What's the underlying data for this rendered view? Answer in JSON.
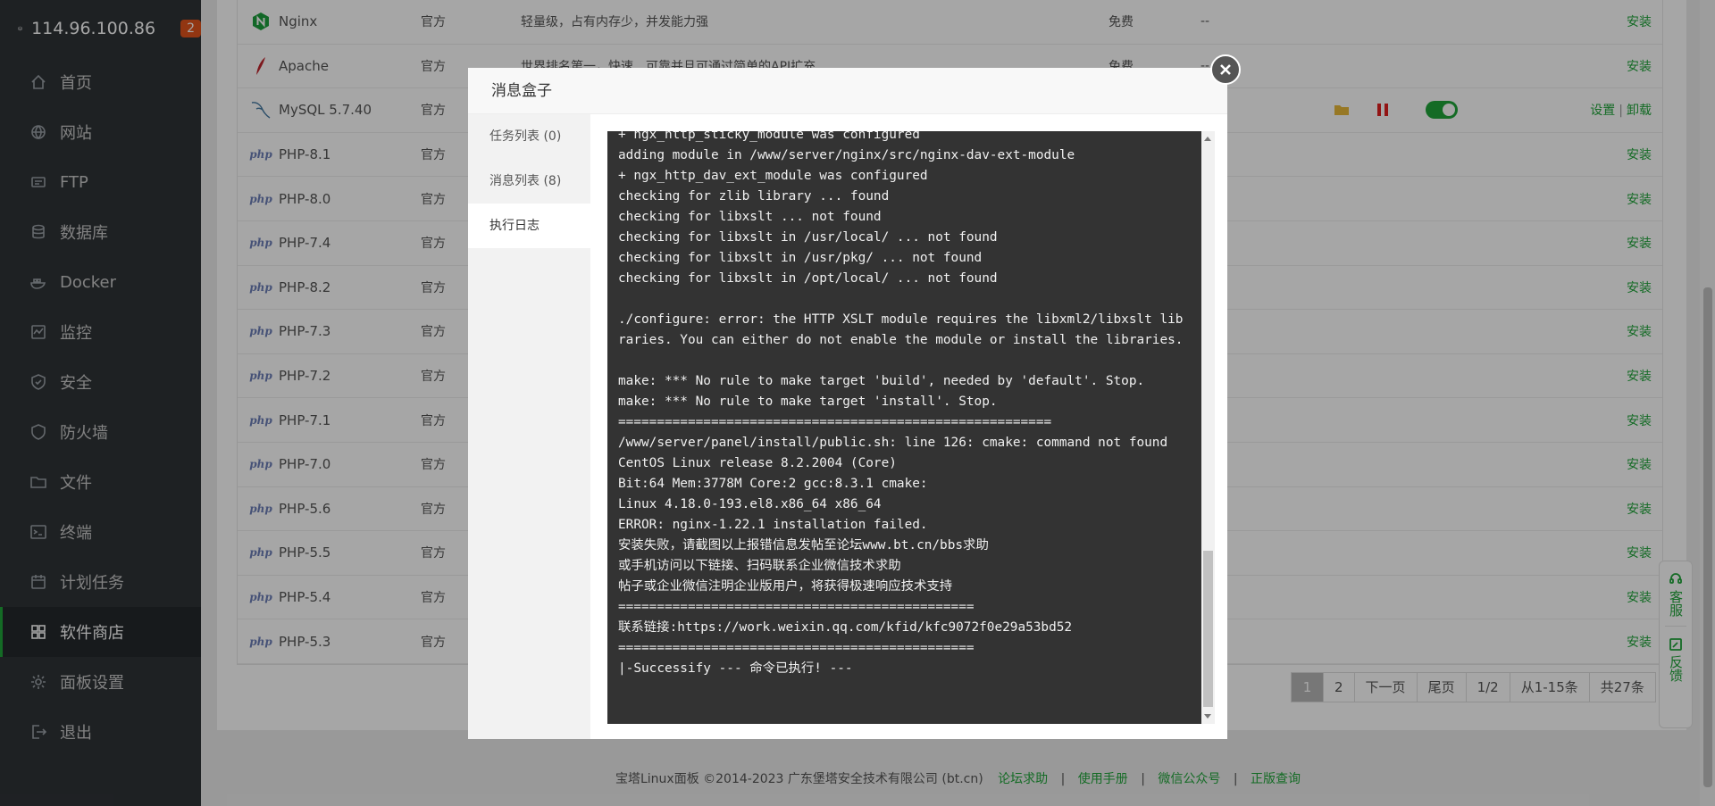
{
  "sidebar": {
    "server_ip": "114.96.100.86",
    "badge_count": "2",
    "items": [
      {
        "label": "首页",
        "icon": "home-icon"
      },
      {
        "label": "网站",
        "icon": "globe-icon"
      },
      {
        "label": "FTP",
        "icon": "ftp-icon"
      },
      {
        "label": "数据库",
        "icon": "database-icon"
      },
      {
        "label": "Docker",
        "icon": "docker-icon"
      },
      {
        "label": "监控",
        "icon": "monitor-icon"
      },
      {
        "label": "安全",
        "icon": "shield-icon"
      },
      {
        "label": "防火墙",
        "icon": "firewall-icon"
      },
      {
        "label": "文件",
        "icon": "folder-icon"
      },
      {
        "label": "终端",
        "icon": "terminal-icon"
      },
      {
        "label": "计划任务",
        "icon": "calendar-icon"
      },
      {
        "label": "软件商店",
        "icon": "grid-icon",
        "active": true
      },
      {
        "label": "面板设置",
        "icon": "gear-icon"
      },
      {
        "label": "退出",
        "icon": "logout-icon"
      }
    ]
  },
  "software_table": {
    "rows": [
      {
        "name": "Nginx",
        "type": "官方",
        "desc": "轻量级，占有内存少，并发能力强",
        "price": "免费",
        "expire": "--",
        "action": "安装",
        "icon": "nginx-icon"
      },
      {
        "name": "Apache",
        "type": "官方",
        "desc": "世界排名第一，快速、可靠并且可通过简单的API扩充",
        "price": "免费",
        "expire": "--",
        "action": "安装",
        "icon": "apache-icon"
      },
      {
        "name": "MySQL 5.7.40",
        "type": "官方",
        "desc": "",
        "price": "",
        "expire": "",
        "action_settings": "设置",
        "action_uninstall": "卸载",
        "icon": "mysql-icon"
      },
      {
        "name": "PHP-8.1",
        "type": "官方",
        "action": "安装",
        "icon": "php-icon"
      },
      {
        "name": "PHP-8.0",
        "type": "官方",
        "action": "安装",
        "icon": "php-icon"
      },
      {
        "name": "PHP-7.4",
        "type": "官方",
        "action": "安装",
        "icon": "php-icon"
      },
      {
        "name": "PHP-8.2",
        "type": "官方",
        "action": "安装",
        "icon": "php-icon"
      },
      {
        "name": "PHP-7.3",
        "type": "官方",
        "action": "安装",
        "icon": "php-icon"
      },
      {
        "name": "PHP-7.2",
        "type": "官方",
        "action": "安装",
        "icon": "php-icon"
      },
      {
        "name": "PHP-7.1",
        "type": "官方",
        "action": "安装",
        "icon": "php-icon"
      },
      {
        "name": "PHP-7.0",
        "type": "官方",
        "action": "安装",
        "icon": "php-icon"
      },
      {
        "name": "PHP-5.6",
        "type": "官方",
        "action": "安装",
        "icon": "php-icon"
      },
      {
        "name": "PHP-5.5",
        "type": "官方",
        "action": "安装",
        "icon": "php-icon"
      },
      {
        "name": "PHP-5.4",
        "type": "官方",
        "action": "安装",
        "icon": "php-icon"
      },
      {
        "name": "PHP-5.3",
        "type": "官方",
        "action": "安装",
        "icon": "php-icon"
      }
    ],
    "php_icon_text": "php"
  },
  "pagination": {
    "current": "1",
    "page2": "2",
    "next": "下一页",
    "last": "尾页",
    "page_info": "1/2",
    "range": "从1-15条",
    "total": "共27条"
  },
  "footer": {
    "copyright": "宝塔Linux面板 ©2014-2023 广东堡塔安全技术有限公司 (bt.cn)",
    "links": [
      "论坛求助",
      "使用手册",
      "微信公众号",
      "正版查询"
    ],
    "separator": "|"
  },
  "modal": {
    "title": "消息盒子",
    "tabs": [
      "任务列表 (0)",
      "消息列表 (8)",
      "执行日志"
    ],
    "active_tab": 2,
    "log_lines": [
      "+ ngx_http_sticky_module was configured",
      "adding module in /www/server/nginx/src/nginx-dav-ext-module",
      "+ ngx_http_dav_ext_module was configured",
      "checking for zlib library ... found",
      "checking for libxslt ... not found",
      "checking for libxslt in /usr/local/ ... not found",
      "checking for libxslt in /usr/pkg/ ... not found",
      "checking for libxslt in /opt/local/ ... not found",
      "",
      "./configure: error: the HTTP XSLT module requires the libxml2/libxslt libraries. You can either do not enable the module or install the libraries.",
      "",
      "make: *** No rule to make target 'build', needed by 'default'. Stop.",
      "make: *** No rule to make target 'install'. Stop.",
      "========================================================",
      "/www/server/panel/install/public.sh: line 126: cmake: command not found",
      "CentOS Linux release 8.2.2004 (Core)",
      "Bit:64 Mem:3778M Core:2 gcc:8.3.1 cmake:",
      "Linux 4.18.0-193.el8.x86_64 x86_64",
      "ERROR: nginx-1.22.1 installation failed.",
      "安装失败，请截图以上报错信息发帖至论坛www.bt.cn/bbs求助",
      "或手机访问以下链接、扫码联系企业微信技术求助",
      "帖子或企业微信注明企业版用户，将获得极速响应技术支持",
      "==============================================",
      "联系链接:https://work.weixin.qq.com/kfid/kfc9072f0e29a53bd52",
      "==============================================",
      "|-Successify --- 命令已执行! ---"
    ]
  },
  "float_service": {
    "customer_service": "客服",
    "feedback": "反馈"
  },
  "colors": {
    "accent": "#20a53a",
    "sidebar_bg": "#2f3337",
    "badge": "#e0541d",
    "log_bg": "#333333"
  }
}
